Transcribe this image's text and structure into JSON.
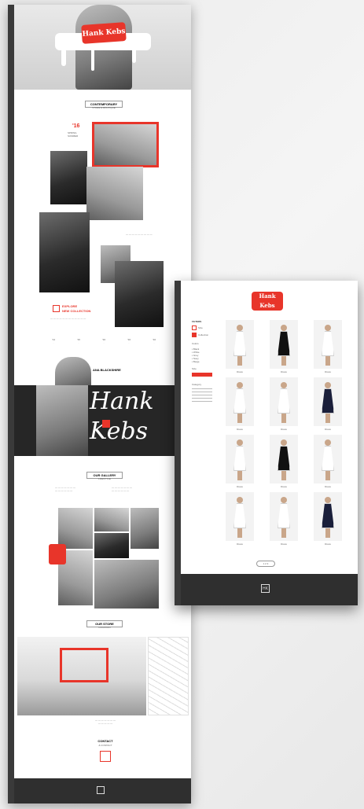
{
  "landing": {
    "hero_logo": "Hank Kebs",
    "about_title": "CONTEMPORARY",
    "about_sub": "STORE & BOUTIQUE",
    "feature_year": "'16",
    "feature_title": "SPRING",
    "feature_sub": "SUMMER",
    "explore_line1": "EXPLORE",
    "explore_line2": "NEW COLLECTION",
    "years": [
      "'14",
      "'15",
      "'16",
      "'16",
      "'16"
    ],
    "person_name": "ANA BLACKSHIRE",
    "big_script": "Hank Kebs",
    "lifestyle_title": "OUR GALLERY",
    "lifestyle_sub": "LIFESTYLE",
    "store_title": "OUR STORE",
    "store_sub": "LOCATION",
    "contact_title": "CONTACT",
    "contact_sub": "& CONTACT"
  },
  "catalog": {
    "logo": "Hank Kebs",
    "filters": {
      "heading": "FILTERS",
      "option1": "Size",
      "option2": "Collection",
      "colors_heading": "Colors",
      "color_items": [
        "Black",
        "White",
        "Grey",
        "Navy",
        "Beige"
      ],
      "size_heading": "Size",
      "category_heading": "Category"
    },
    "products": [
      {
        "color": "#ffffff",
        "label": "Dress"
      },
      {
        "color": "#111111",
        "label": "Dress"
      },
      {
        "color": "#ffffff",
        "label": "Dress"
      },
      {
        "color": "#ffffff",
        "label": "Dress"
      },
      {
        "color": "#ffffff",
        "label": "Dress"
      },
      {
        "color": "#1a1f3a",
        "label": "Dress"
      },
      {
        "color": "#ffffff",
        "label": "Dress"
      },
      {
        "color": "#111111",
        "label": "Dress"
      },
      {
        "color": "#ffffff",
        "label": "Dress"
      },
      {
        "color": "#ffffff",
        "label": "Dress"
      },
      {
        "color": "#ffffff",
        "label": "Dress"
      },
      {
        "color": "#1a1f3a",
        "label": "Dress"
      }
    ],
    "pager": "1 2 3",
    "footer_logo": "HK"
  },
  "colors": {
    "accent": "#e8352a",
    "dark": "#2f2f2f"
  }
}
